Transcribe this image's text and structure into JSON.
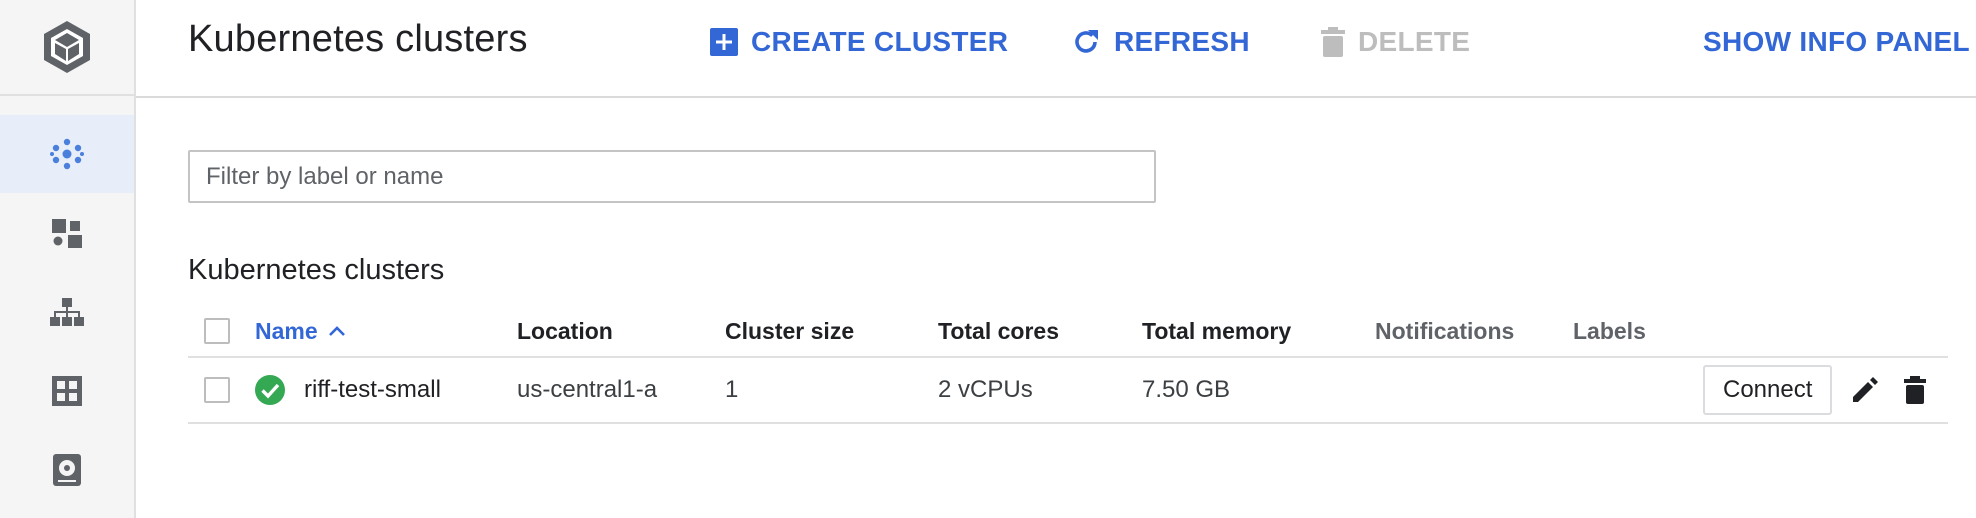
{
  "header": {
    "title": "Kubernetes clusters",
    "toolbar": {
      "create_label": "CREATE CLUSTER",
      "refresh_label": "REFRESH",
      "delete_label": "DELETE",
      "info_panel_label": "SHOW INFO PANEL"
    }
  },
  "sidebar": {
    "items": [
      {
        "icon": "clusters-icon",
        "active": true
      },
      {
        "icon": "workloads-icon",
        "active": false
      },
      {
        "icon": "services-icon",
        "active": false
      },
      {
        "icon": "applications-icon",
        "active": false
      },
      {
        "icon": "storage-icon",
        "active": false
      }
    ]
  },
  "filter": {
    "placeholder": "Filter by label or name",
    "value": ""
  },
  "section": {
    "title": "Kubernetes clusters"
  },
  "table": {
    "columns": [
      "Name",
      "Location",
      "Cluster size",
      "Total cores",
      "Total memory",
      "Notifications",
      "Labels"
    ],
    "sort_indicator": "^",
    "rows": [
      {
        "status": "ok",
        "name": "riff-test-small",
        "location": "us-central1-a",
        "cluster_size": "1",
        "total_cores": "2 vCPUs",
        "total_memory": "7.50 GB",
        "notifications": "",
        "labels": "",
        "connect_label": "Connect"
      }
    ]
  },
  "colors": {
    "accent": "#3367d6",
    "status_ok": "#34a853",
    "disabled": "#bdbdbd",
    "rail_bg": "#f5f5f5",
    "rail_active_bg": "#e8eef9"
  }
}
